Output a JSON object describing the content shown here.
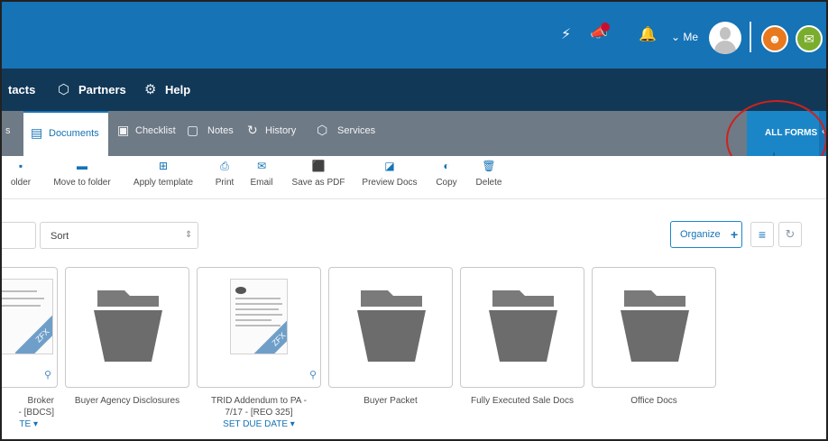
{
  "topbar": {
    "me_label": "Me",
    "icons": [
      "lightning-icon",
      "megaphone-icon",
      "bell-icon",
      "avatar",
      "people-icon",
      "chat-icon"
    ],
    "brand_color": "#1573b6"
  },
  "nav": {
    "items": [
      {
        "label": "tacts",
        "icon": ""
      },
      {
        "label": "Partners",
        "icon": "partners-icon"
      },
      {
        "label": "Help",
        "icon": "help-icon"
      }
    ]
  },
  "tabs": {
    "items": [
      {
        "label": "s",
        "active": false
      },
      {
        "label": "Documents",
        "active": true
      },
      {
        "label": "Checklist",
        "active": false
      },
      {
        "label": "Notes",
        "active": false
      },
      {
        "label": "History",
        "active": false
      },
      {
        "label": "Services",
        "active": false
      }
    ],
    "all_forms": "ALL FORMS"
  },
  "toolbar": {
    "items": [
      {
        "label": "older",
        "icon": "new-folder-icon"
      },
      {
        "label": "Move to folder",
        "icon": "folder-icon"
      },
      {
        "label": "Apply template",
        "icon": "template-icon"
      },
      {
        "label": "Print",
        "icon": "print-icon"
      },
      {
        "label": "Email",
        "icon": "email-icon"
      },
      {
        "label": "Save as PDF",
        "icon": "pdf-icon"
      },
      {
        "label": "Preview Docs",
        "icon": "preview-icon"
      },
      {
        "label": "Copy",
        "icon": "copy-icon"
      },
      {
        "label": "Delete",
        "icon": "trash-icon"
      }
    ]
  },
  "filters": {
    "sort_label": "Sort",
    "organize_label": "Organize"
  },
  "cards": [
    {
      "label": "Broker\n- [BDCS]",
      "due": "TE ▾",
      "type": "doc"
    },
    {
      "label": "Buyer Agency Disclosures",
      "due": "",
      "type": "folder"
    },
    {
      "label": "TRID Addendum to PA -\n7/17 - [REO 325]",
      "due": "SET DUE DATE ▾",
      "type": "doc"
    },
    {
      "label": "Buyer Packet",
      "due": "",
      "type": "folder"
    },
    {
      "label": "Fully Executed Sale Docs",
      "due": "",
      "type": "folder"
    },
    {
      "label": "Office Docs",
      "due": "",
      "type": "folder"
    }
  ],
  "doc_ribbon": "ZFX"
}
